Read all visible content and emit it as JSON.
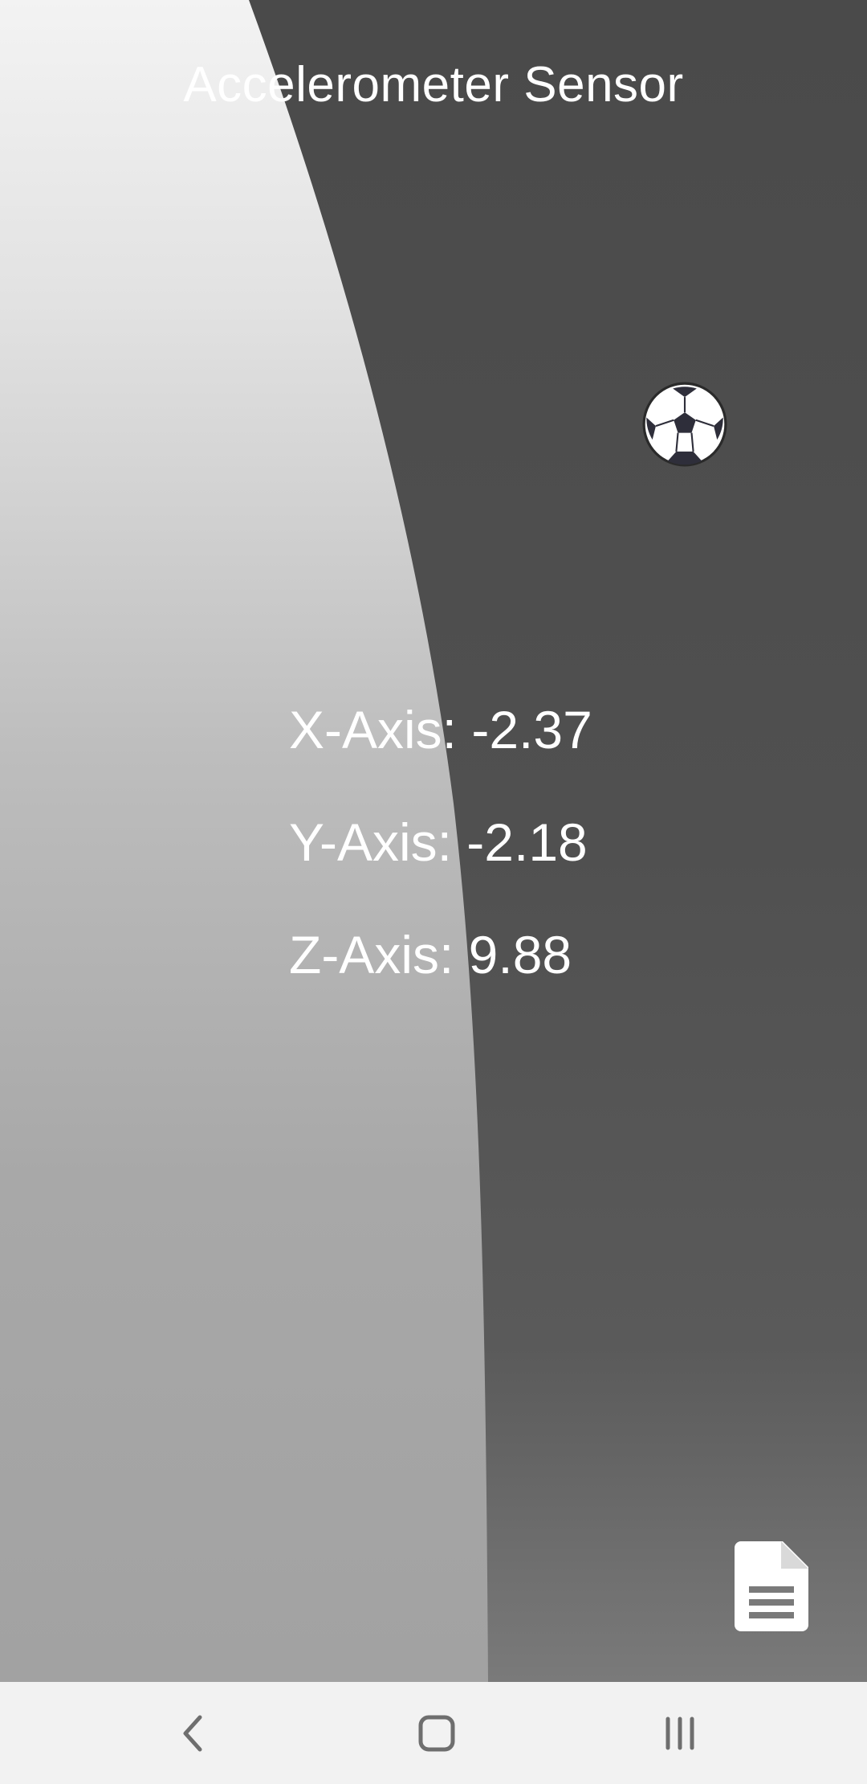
{
  "app": {
    "title": "Accelerometer Sensor"
  },
  "readings": {
    "x_label": "X-Axis: -2.37",
    "y_label": "Y-Axis: -2.18",
    "z_label": "Z-Axis: 9.88"
  },
  "icons": {
    "ball": "soccer-ball-icon",
    "fab": "document-icon",
    "nav_back": "back-chevron-icon",
    "nav_home": "home-square-icon",
    "nav_recent": "recent-apps-icon"
  },
  "colors": {
    "text": "#ffffff",
    "dark_panel": "#505050",
    "navbar": "#f2f2f2",
    "nav_icon": "#6e6e6e"
  }
}
